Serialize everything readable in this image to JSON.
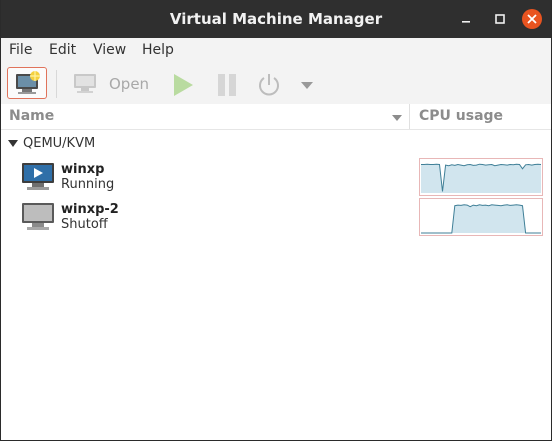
{
  "window": {
    "title": "Virtual Machine Manager"
  },
  "menu": [
    "File",
    "Edit",
    "View",
    "Help"
  ],
  "toolbar": {
    "open_label": "Open",
    "icons": [
      "new-vm-icon",
      "monitor-icon",
      "run-icon",
      "pause-icon",
      "power-icon",
      "dropdown-icon"
    ]
  },
  "columns": {
    "name": "Name",
    "cpu": "CPU usage"
  },
  "connection": {
    "label": "QEMU/KVM",
    "expanded": true
  },
  "vms": [
    {
      "name": "winxp",
      "state": "Running",
      "icon": "vm-running-icon",
      "cpu_history": [
        92,
        92,
        93,
        92,
        92,
        93,
        92,
        5,
        90,
        88,
        91,
        89,
        92,
        90,
        88,
        91,
        92,
        89,
        90,
        93,
        92,
        90,
        91,
        92,
        88,
        90,
        92,
        91,
        90,
        92,
        91,
        93,
        92,
        78,
        91,
        92,
        90,
        92,
        93,
        92
      ]
    },
    {
      "name": "winxp-2",
      "state": "Shutoff",
      "icon": "vm-shutoff-icon",
      "cpu_history": [
        0,
        0,
        0,
        0,
        0,
        0,
        0,
        0,
        0,
        0,
        0,
        88,
        90,
        89,
        91,
        90,
        85,
        90,
        88,
        91,
        89,
        90,
        88,
        91,
        90,
        89,
        88,
        90,
        91,
        89,
        90,
        91,
        90,
        88,
        0,
        0,
        0,
        0,
        0,
        0
      ]
    }
  ],
  "colors": {
    "titlebar": "#2f2f2f",
    "spark_fill": "#d1e5ee",
    "spark_line": "#3f7f97",
    "spark_border": "#e8b7b7",
    "new_vm_border": "#e0735b"
  }
}
